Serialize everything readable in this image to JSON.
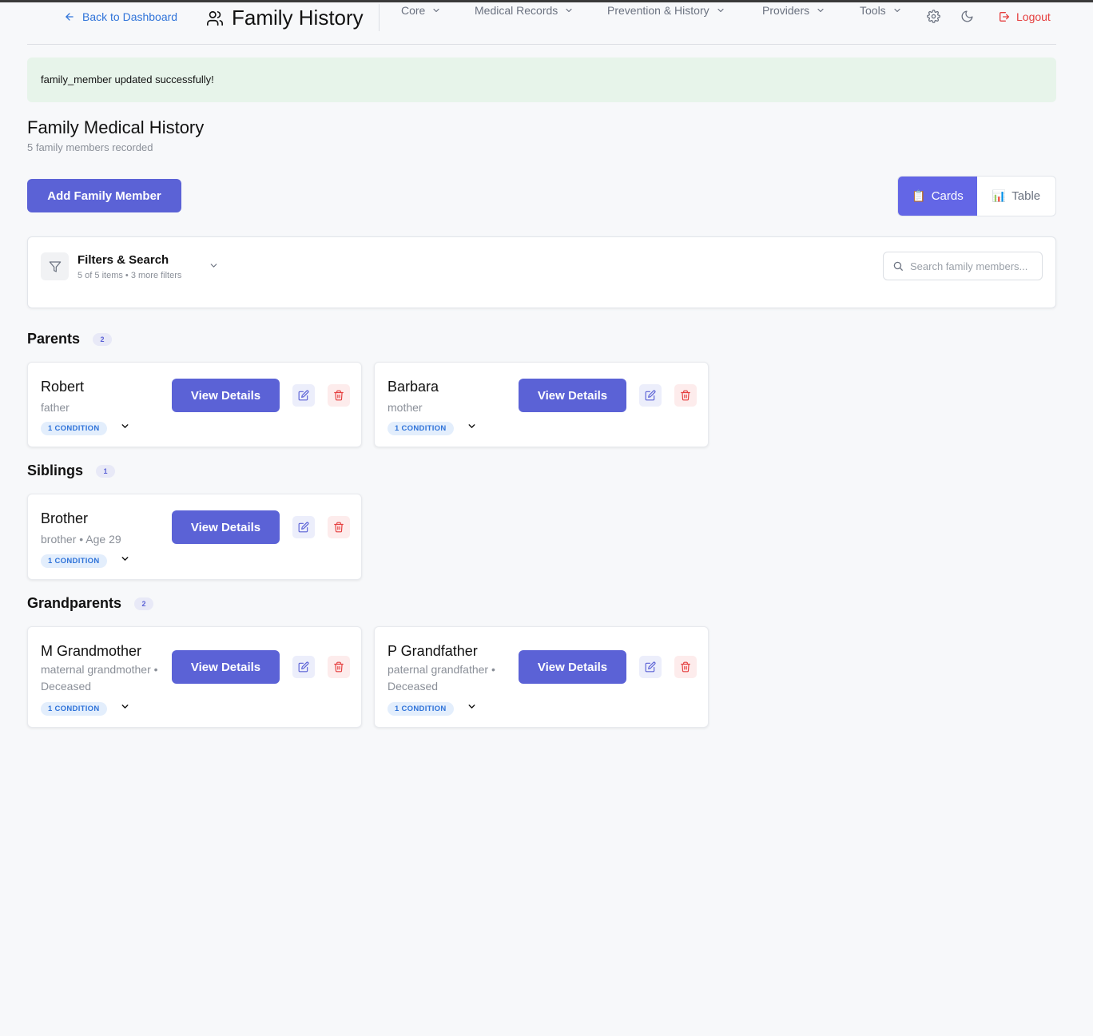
{
  "header": {
    "back_label": "Back to Dashboard",
    "title": "Family History",
    "nav": {
      "core": "Core",
      "medical_records": "Medical Records",
      "prevention_history": "Prevention & History",
      "providers": "Providers",
      "tools": "Tools"
    },
    "logout_label": "Logout"
  },
  "alert": {
    "message": "family_member updated successfully!"
  },
  "page": {
    "title": "Family Medical History",
    "subtitle": "5 family members recorded",
    "add_button": "Add Family Member"
  },
  "view_toggle": {
    "cards_label": "Cards",
    "cards_emoji": "📋",
    "table_label": "Table",
    "table_emoji": "📊",
    "active": "cards"
  },
  "filters": {
    "title": "Filters & Search",
    "summary": "5 of 5 items • 3 more filters",
    "search_placeholder": "Search family members..."
  },
  "sections": {
    "parents": {
      "title": "Parents",
      "count": "2",
      "members": [
        {
          "name": "Robert",
          "relation": "father",
          "conditions": "1 CONDITION"
        },
        {
          "name": "Barbara",
          "relation": "mother",
          "conditions": "1 CONDITION"
        }
      ]
    },
    "siblings": {
      "title": "Siblings",
      "count": "1",
      "members": [
        {
          "name": "Brother",
          "relation": "brother • Age 29",
          "conditions": "1 CONDITION"
        }
      ]
    },
    "grandparents": {
      "title": "Grandparents",
      "count": "2",
      "members": [
        {
          "name": "M Grandmother",
          "relation": "maternal grandmother • Deceased",
          "conditions": "1 CONDITION"
        },
        {
          "name": "P Grandfather",
          "relation": "paternal grandfather • Deceased",
          "conditions": "1 CONDITION"
        }
      ]
    }
  },
  "card_actions": {
    "view_label": "View Details"
  },
  "colors": {
    "primary": "#5b62d6",
    "link": "#2f73d9",
    "danger": "#e53e3e",
    "success_bg": "#e7f4ea",
    "page_bg": "#f7f8fa"
  }
}
